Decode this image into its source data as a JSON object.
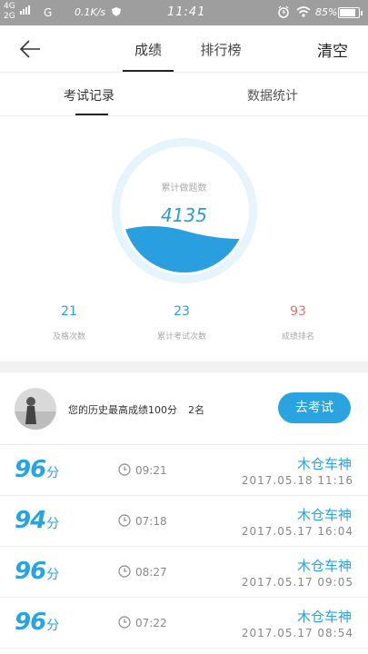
{
  "status_bar": {
    "network_top": "4G",
    "network_bottom": "2G",
    "carrier": "G",
    "speed": "0.1K/s",
    "time": "11:41",
    "battery": "85%",
    "battery_level": 0.85
  },
  "nav": {
    "tabs": [
      "成绩",
      "排行榜"
    ],
    "clear_label": "清空"
  },
  "sub_tabs": [
    "考试记录",
    "数据统计"
  ],
  "gauge": {
    "label": "累计做题数",
    "value": "4135"
  },
  "stats": [
    {
      "value": "21",
      "label": "及格次数",
      "color": "#2a9fd8"
    },
    {
      "value": "23",
      "label": "累计考试次数",
      "color": "#2a9fd8"
    },
    {
      "value": "93",
      "label": "成绩排名",
      "color": "#e57373"
    }
  ],
  "best": {
    "text": "您的历史最高成绩100分",
    "rank": "2名",
    "button_label": "去考试"
  },
  "records": [
    {
      "score": "96",
      "unit": "分",
      "duration": "09:21",
      "name": "木仓车神",
      "date": "2017.05.18  11:16"
    },
    {
      "score": "94",
      "unit": "分",
      "duration": "07:18",
      "name": "木仓车神",
      "date": "2017.05.17  16:04"
    },
    {
      "score": "96",
      "unit": "分",
      "duration": "08:27",
      "name": "木仓车神",
      "date": "2017.05.17  09:05"
    },
    {
      "score": "96",
      "unit": "分",
      "duration": "07:22",
      "name": "木仓车神",
      "date": "2017.05.17  08:54"
    }
  ],
  "colors": {
    "accent": "#29a4e0",
    "status_bar": "#9e9e9e",
    "rank_red": "#e57373"
  }
}
